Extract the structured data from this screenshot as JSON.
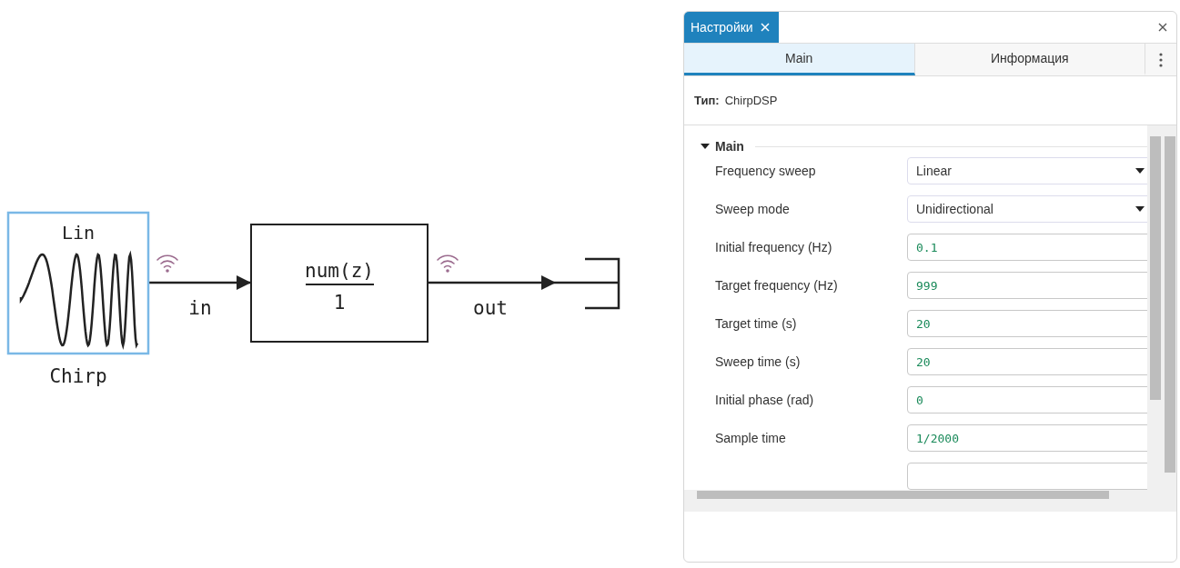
{
  "diagram": {
    "blocks": [
      {
        "kind": "chirp",
        "title": "Lin",
        "label": "Chirp",
        "selected": true
      },
      {
        "kind": "transfer",
        "numerator": "num(z)",
        "denominator": "1"
      },
      {
        "kind": "terminator"
      }
    ],
    "links": [
      {
        "label": "in"
      },
      {
        "label": "out"
      }
    ]
  },
  "panel": {
    "tab": {
      "title": "Настройки"
    },
    "tabs": [
      {
        "label": "Main",
        "selected": true
      },
      {
        "label": "Информация",
        "selected": false
      }
    ],
    "type": {
      "label": "Тип:",
      "value": "ChirpDSP"
    },
    "section": {
      "title": "Main",
      "expanded": true
    },
    "fields": [
      {
        "kind": "select",
        "label": "Frequency sweep",
        "value": "Linear"
      },
      {
        "kind": "select",
        "label": "Sweep mode",
        "value": "Unidirectional"
      },
      {
        "kind": "input",
        "label": "Initial frequency (Hz)",
        "value": "0.1"
      },
      {
        "kind": "input",
        "label": "Target frequency (Hz)",
        "value": "999"
      },
      {
        "kind": "input",
        "label": "Target time (s)",
        "value": "20"
      },
      {
        "kind": "input",
        "label": "Sweep time (s)",
        "value": "20"
      },
      {
        "kind": "input",
        "label": "Initial phase (rad)",
        "value": "0"
      },
      {
        "kind": "input",
        "label": "Sample time",
        "value": "1/2000"
      }
    ]
  }
}
